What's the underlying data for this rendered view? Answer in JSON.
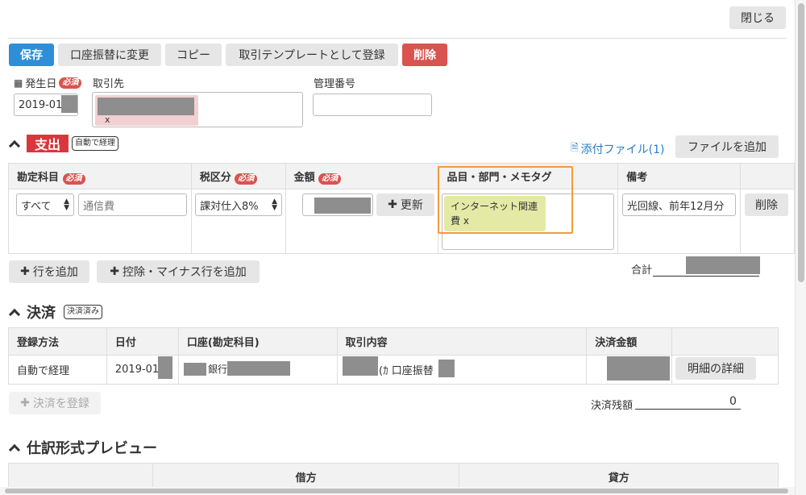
{
  "window": {
    "close_label": "閉じる"
  },
  "toolbar": {
    "save_label": "保存",
    "change_label": "口座振替に変更",
    "copy_label": "コピー",
    "template_label": "取引テンプレートとして登録",
    "delete_label": "削除"
  },
  "header_fields": {
    "date_label": "発生日",
    "required_label": "必須",
    "date_value": "2019-01-",
    "partner_label": "取引先",
    "partner_remove": "x",
    "manage_no_label": "管理番号",
    "manage_no_value": ""
  },
  "expense": {
    "title": "支出",
    "auto_badge": "自動で経理",
    "attach_link": "添付ファイル(1)",
    "add_file_label": "ファイルを追加",
    "columns": {
      "account": "勘定科目",
      "tax": "税区分",
      "amount": "金額",
      "tags": "品目・部門・メモタグ",
      "note": "備考"
    },
    "row": {
      "account_select": "すべて",
      "account_value": "通信費",
      "tax_value": "課対仕入8%",
      "update_label": "更新",
      "tag_label": "インターネット関連費",
      "tag_line1": "インターネット関連",
      "tag_line2": "費 x",
      "note_value": "光回線、前年12月分",
      "delete_label": "削除"
    },
    "add_row_label": "行を追加",
    "add_deduction_label": "控除・マイナス行を追加",
    "total_label": "合計"
  },
  "settlement": {
    "title": "決済",
    "badge": "決済済み",
    "columns": {
      "method": "登録方法",
      "date": "日付",
      "account": "口座(勘定科目)",
      "content": "取引内容",
      "amount": "決済金額"
    },
    "row": {
      "method": "自動で経理",
      "date": "2019-01-",
      "account_suffix": "銀行",
      "content_mid": "(ｶ 口座振替",
      "detail_label": "明細の詳細"
    },
    "register_label": "決済を登録",
    "balance_label": "決済残額",
    "balance_value": "0"
  },
  "preview": {
    "title": "仕訳形式プレビュー",
    "debit_label": "借方",
    "credit_label": "貸方"
  },
  "colors": {
    "primary": "#2f8ed8",
    "danger": "#d9534f",
    "expense_badge": "#d9373d",
    "tag_bg": "#e4eaa5",
    "highlight": "#f39a3b",
    "link": "#2a7dc4"
  }
}
